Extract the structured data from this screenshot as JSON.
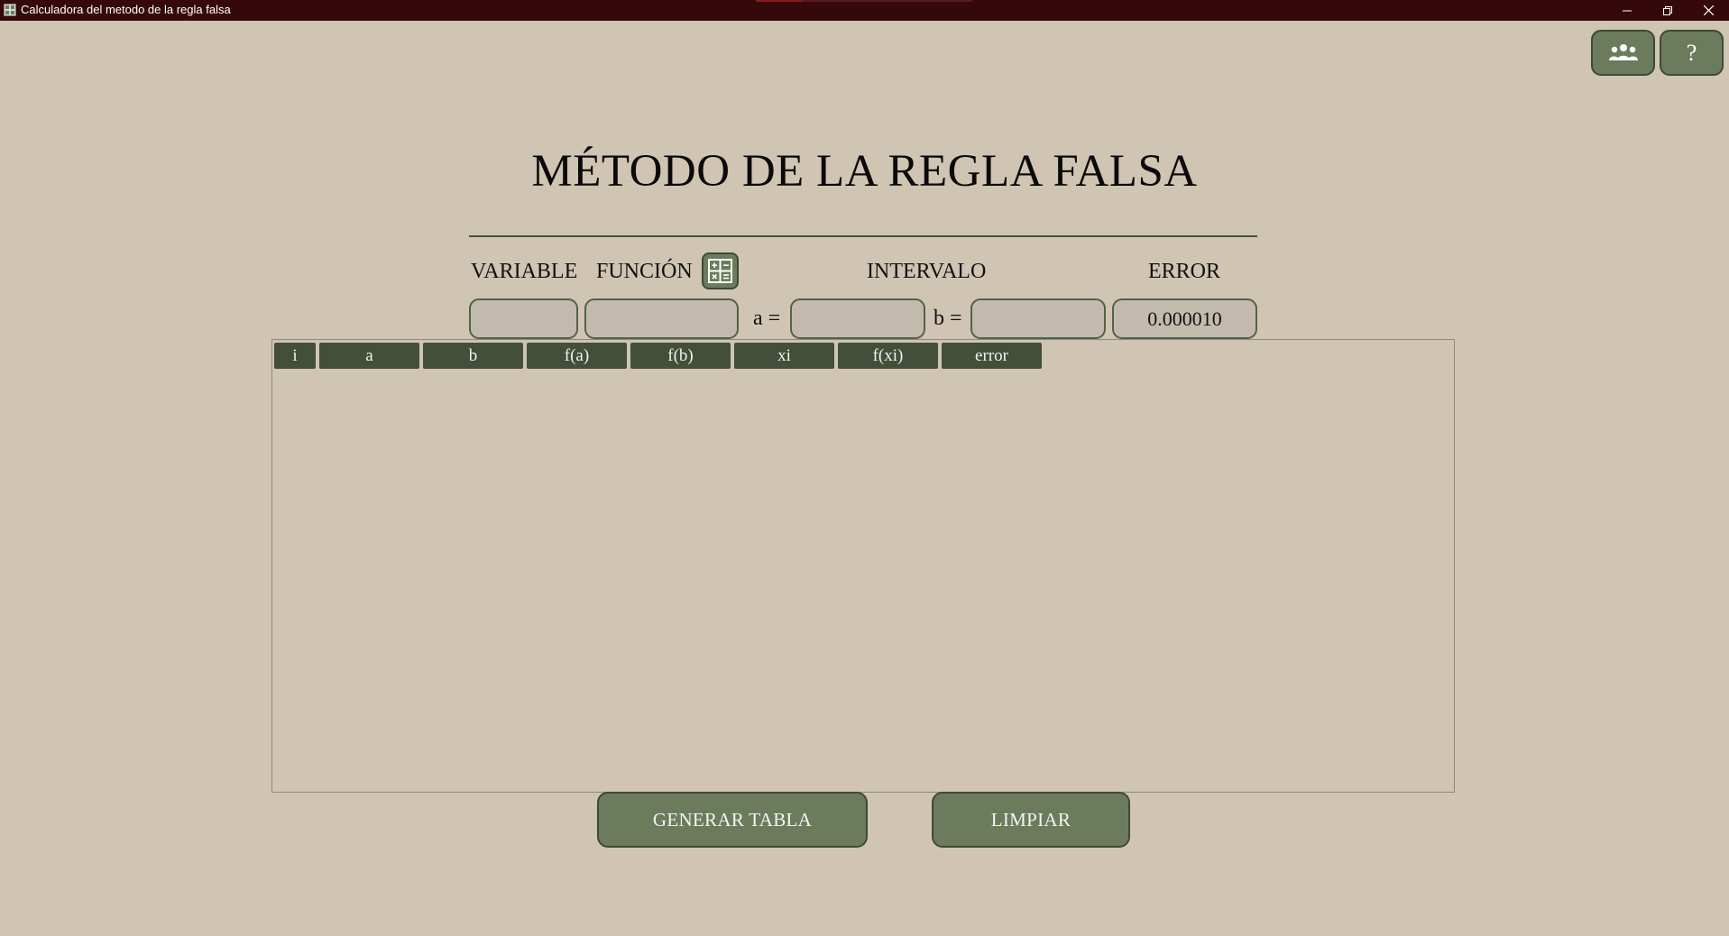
{
  "window": {
    "title": "Calculadora del metodo de la regla falsa",
    "minimize_icon": "minimize-icon",
    "restore_icon": "restore-icon",
    "close_icon": "close-icon"
  },
  "top_buttons": {
    "team_icon": "team-icon",
    "help_label": "?"
  },
  "page": {
    "title": "MÉTODO DE LA REGLA FALSA"
  },
  "form": {
    "variable_label": "VARIABLE",
    "funcion_label": "FUNCIÓN",
    "funcion_icon": "calculator-icon",
    "intervalo_label": "INTERVALO",
    "error_label": "ERROR",
    "variable_value": "",
    "funcion_value": "",
    "a_label": "a =",
    "a_value": "",
    "b_label": "b =",
    "b_value": "",
    "error_value": "0.000010"
  },
  "table": {
    "columns": [
      "i",
      "a",
      "b",
      "f(a)",
      "f(b)",
      "xi",
      "f(xi)",
      "error"
    ],
    "rows": []
  },
  "actions": {
    "generate_label": "GENERAR TABLA",
    "clear_label": "LIMPIAR"
  },
  "colors": {
    "background": "#d0c4b2",
    "titlebar": "#35090b",
    "button": "#6d7b5d",
    "header_cell": "#434f38"
  }
}
